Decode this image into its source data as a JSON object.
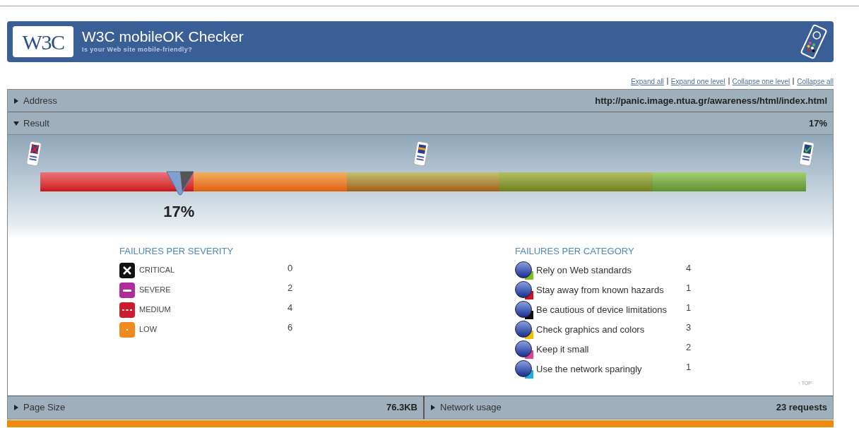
{
  "header": {
    "logo": "W3C",
    "title": "W3C mobileOK Checker",
    "subtitle": "Is your Web site mobile-friendly?"
  },
  "links": [
    "Expand all",
    "Expand one level",
    "Collapse one level",
    "Collapse all"
  ],
  "address": {
    "label": "Address",
    "value": "http://panic.image.ntua.gr/awareness/html/index.html",
    "expanded": false
  },
  "result": {
    "label": "Result",
    "value": "17%",
    "expanded": true
  },
  "meter": {
    "level": 0.17,
    "reading": "17%"
  },
  "severity": {
    "heading": "FAILURES PER SEVERITY",
    "items": [
      {
        "kind": "critical",
        "label": "CRITICAL",
        "count": "0"
      },
      {
        "kind": "severe",
        "label": "SEVERE",
        "count": "2"
      },
      {
        "kind": "medium",
        "label": "MEDIUM",
        "count": "4"
      },
      {
        "kind": "low",
        "label": "LOW",
        "count": "6"
      }
    ]
  },
  "category": {
    "heading": "FAILURES PER CATEGORY",
    "items": [
      {
        "label": "Rely on Web standards",
        "count": "4",
        "color": "#7cc020"
      },
      {
        "label": "Stay away from known hazards",
        "count": "1",
        "color": "#d01020"
      },
      {
        "label": "Be cautious of device limitations",
        "count": "1",
        "color": "#101010"
      },
      {
        "label": "Check graphics and colors",
        "count": "3",
        "color": "#f0c000"
      },
      {
        "label": "Keep it small",
        "count": "2",
        "color": "#e04090"
      },
      {
        "label": "Use the network sparingly",
        "count": "1",
        "color": "#20b0e0"
      }
    ]
  },
  "top_link": "↑ TOP",
  "footer": [
    {
      "label": "Page Size",
      "value": "76.3KB",
      "expanded": false
    },
    {
      "label": "Network usage",
      "value": "23 requests",
      "expanded": false
    }
  ]
}
